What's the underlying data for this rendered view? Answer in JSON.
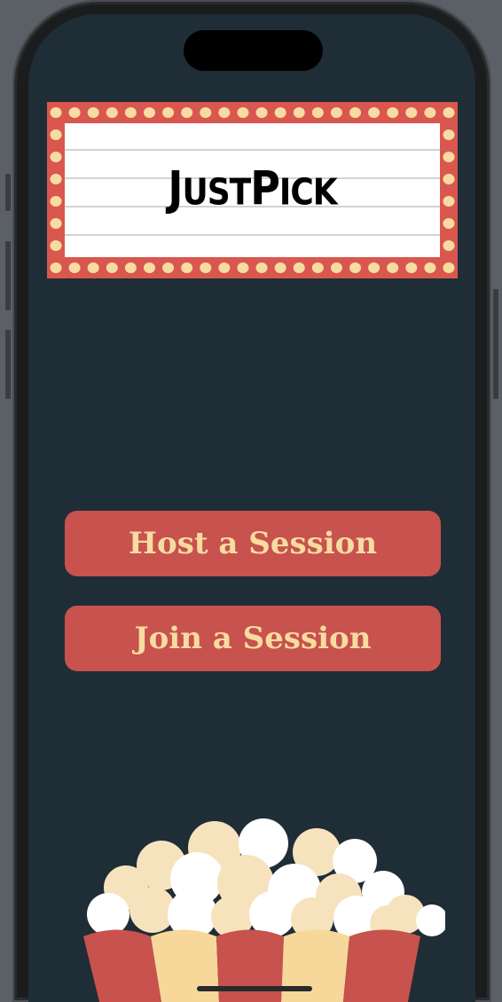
{
  "app": {
    "title_big_j": "J",
    "title_ust": "UST",
    "title_big_p": "P",
    "title_ick": "ICK"
  },
  "actions": {
    "host_label": "Host a Session",
    "join_label": "Join a Session"
  },
  "colors": {
    "background": "#1f2d37",
    "button": "#c8524d",
    "button_text": "#f7dca1",
    "marquee_frame": "#d9574f",
    "marquee_bulb": "#f7dca1"
  },
  "icons": {
    "marquee": "marquee-sign-icon",
    "popcorn": "popcorn-bucket-icon"
  }
}
